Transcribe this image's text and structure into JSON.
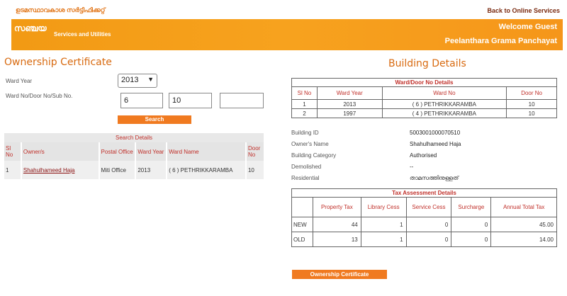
{
  "header": {
    "top_link_left": "ഉടമസ്ഥാവകാശ സർട്ടിഫിക്കറ്റ്",
    "top_link_right": "Back to Online Services",
    "logo_text": "സഞ്ചയ",
    "logo_subtitle": "Services and Utilities",
    "welcome": "Welcome Guest",
    "panchayat": "Peelanthara Grama Panchayat"
  },
  "ownership": {
    "title": "Ownership Certificate",
    "ward_year_label": "Ward Year",
    "ward_year_value": "2013",
    "door_label": "Ward No/Door No/Sub No.",
    "ward_no_value": "6",
    "door_no_value": "10",
    "sub_no_value": "",
    "search_button": "Search"
  },
  "search_table": {
    "caption": "Search Details",
    "headers": [
      "Sl No",
      "Owner/s",
      "Postal Office",
      "Ward Year",
      "Ward Name",
      "Door No"
    ],
    "rows": [
      {
        "sl": "1",
        "owner": "Shahulhameed Haja",
        "postal": "Miti Office",
        "year": "2013",
        "ward": "( 6 ) PETHRIKKARAMBA",
        "door": "10"
      }
    ]
  },
  "building": {
    "title": "Building Details",
    "ward_table": {
      "caption": "Ward/Door No Details",
      "headers": [
        "Sl No",
        "Ward Year",
        "Ward No",
        "Door No"
      ],
      "rows": [
        {
          "sl": "1",
          "year": "2013",
          "ward": "( 6 ) PETHRIKKARAMBA",
          "door": "10"
        },
        {
          "sl": "2",
          "year": "1997",
          "ward": "( 4 ) PETHRIKKARAMBA",
          "door": "10"
        }
      ]
    },
    "info": [
      {
        "label": "Building ID",
        "value": "5003001000070510"
      },
      {
        "label": "Owner's Name",
        "value": "Shahulhameed Haja"
      },
      {
        "label": "Building Category",
        "value": "Authorised"
      },
      {
        "label": "Demolished",
        "value": "--"
      },
      {
        "label": "Residential",
        "value": "താമസത്തിനുള്ളത്"
      }
    ],
    "tax_table": {
      "caption": "Tax Assessment Details",
      "headers": [
        "",
        "Property Tax",
        "Library Cess",
        "Service Cess",
        "Surcharge",
        "Annual Total Tax"
      ],
      "rows": [
        {
          "label": "NEW",
          "property": "44",
          "library": "1",
          "service": "0",
          "surcharge": "0",
          "total": "45.00"
        },
        {
          "label": "OLD",
          "property": "13",
          "library": "1",
          "service": "0",
          "surcharge": "0",
          "total": "14.00"
        }
      ]
    },
    "cert_button": "Ownership Certificate"
  }
}
